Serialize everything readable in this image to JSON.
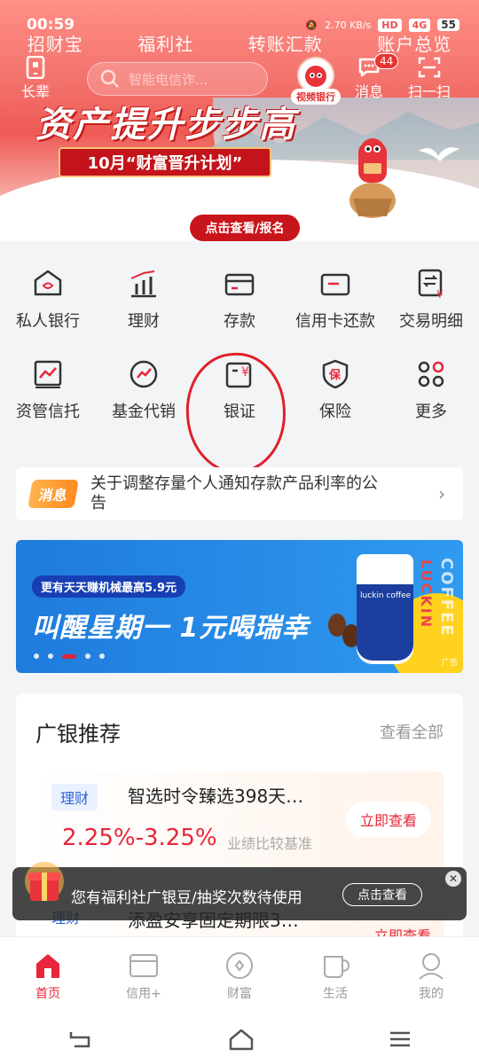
{
  "status_bar": {
    "time": "00:59",
    "net_speed": "2.70 KB/s",
    "hd": "HD",
    "signal": "4G",
    "battery": "55"
  },
  "quick_nav": [
    "招财宝",
    "福利社",
    "转账汇款",
    "账户总览"
  ],
  "header": {
    "elder_mode": "长辈",
    "search_placeholder": "智能电信诈...",
    "video_bank": "视频银行",
    "messages": "消息",
    "message_count": "44",
    "scan": "扫一扫"
  },
  "hero": {
    "headline": "资产提升步步高",
    "subtitle": "10月“财富晋升计划”",
    "cta": "点击查看/报名"
  },
  "services": [
    [
      {
        "label": "私人银行",
        "icon": "private-bank-icon"
      },
      {
        "label": "理财",
        "icon": "wealth-chart-icon"
      },
      {
        "label": "存款",
        "icon": "deposit-card-icon"
      },
      {
        "label": "信用卡还款",
        "icon": "credit-card-icon"
      },
      {
        "label": "交易明细",
        "icon": "transaction-detail-icon"
      }
    ],
    [
      {
        "label": "资管信托",
        "icon": "trust-icon"
      },
      {
        "label": "基金代销",
        "icon": "fund-icon"
      },
      {
        "label": "银证",
        "icon": "bank-securities-icon"
      },
      {
        "label": "保险",
        "icon": "insurance-shield-icon"
      },
      {
        "label": "更多",
        "icon": "more-grid-icon"
      }
    ]
  ],
  "notice": {
    "tag": "消息",
    "text": "关于调整存量个人通知存款产品利率的公告"
  },
  "ad": {
    "pill": "更有天天赚机械最高5.9元",
    "headline": "叫醒星期一 1元喝瑞幸",
    "brand_vertical": "COFFEE",
    "brand_vertical2": "LUCKIN",
    "ad_label": "广告",
    "cup_brand": "luckin coffee",
    "current_slide": 3,
    "total_slides": 5
  },
  "recommend": {
    "title": "广银推荐",
    "view_all": "查看全部",
    "products": [
      {
        "tag": "理财",
        "name": "智选时令臻选398天…",
        "rate": "2.25%-3.25%",
        "basis": "业绩比较基准",
        "button": "立即查看"
      },
      {
        "tag": "理财",
        "name": "添盈安享固定期限3…",
        "button": "立即查看"
      }
    ]
  },
  "toast": {
    "text": "您有福利社广银豆/抽奖次数待使用",
    "button": "点击查看"
  },
  "bottom_nav": [
    {
      "label": "首页",
      "icon": "home-icon",
      "active": true
    },
    {
      "label": "信用+",
      "icon": "credit-plus-icon",
      "active": false
    },
    {
      "label": "财富",
      "icon": "wealth-icon",
      "active": false
    },
    {
      "label": "生活",
      "icon": "life-cup-icon",
      "active": false
    },
    {
      "label": "我的",
      "icon": "profile-icon",
      "active": false
    }
  ],
  "colors": {
    "brand_red": "#e8253a",
    "hero_red": "#ef5a55",
    "annotation_red": "#e01f2a"
  }
}
